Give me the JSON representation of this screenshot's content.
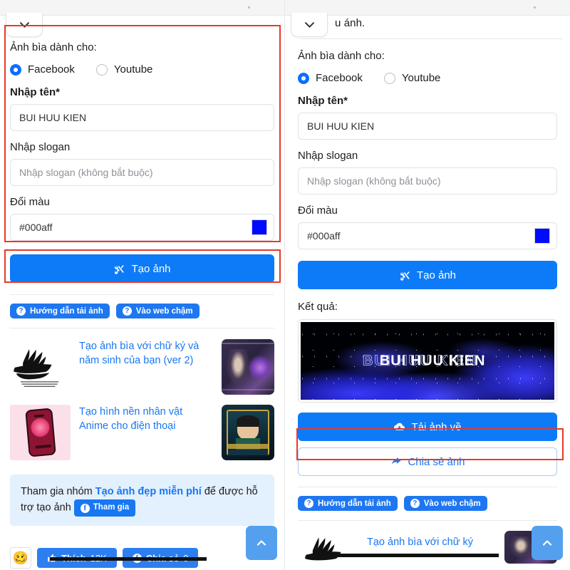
{
  "header": {
    "collapse_icon": "chevron-down-icon",
    "right_partial_text": "u ánh."
  },
  "form": {
    "cover_for_label": "Ảnh bìa dành cho:",
    "radios": [
      {
        "label": "Facebook",
        "selected": true
      },
      {
        "label": "Youtube",
        "selected": false
      }
    ],
    "name_label": "Nhập tên*",
    "name_value": "BUI HUU KIEN",
    "slogan_label": "Nhập slogan",
    "slogan_placeholder": "Nhập slogan (không bắt buộc)",
    "color_label": "Đổi màu",
    "color_value": "#000aff",
    "color_swatch_hex": "#000aff",
    "create_button": "Tạo ảnh",
    "create_button_icon": "scissors-icon"
  },
  "result": {
    "label": "Kết quả:",
    "cover_text": "BUI HUU KIEN",
    "download_button": "Tải ảnh về",
    "download_icon": "cloud-download-icon",
    "share_button": "Chia sẻ ảnh",
    "share_icon": "share-arrow-icon"
  },
  "help_pills": [
    {
      "label": "Hướng dẫn tải ảnh",
      "icon": "question-circle-icon"
    },
    {
      "label": "Vào web chậm",
      "icon": "question-circle-icon"
    }
  ],
  "articles": [
    {
      "title": "Tạo ảnh bìa với chữ ký và năm sinh của bạn (ver 2)"
    },
    {
      "title": "Tạo hình nền nhân vật Anime cho điện thoại"
    }
  ],
  "article_partial": {
    "title": "Tạo ảnh bìa với chữ ký"
  },
  "join_banner": {
    "prefix": "Tham gia nhóm ",
    "group_name": "Tạo ảnh đẹp miễn phí",
    "suffix": " để được hỗ trợ tạo ảnh",
    "button": "Tham gia",
    "button_icon": "facebook-icon"
  },
  "social_bar": {
    "emoji": "🥴",
    "like_label": "Thích",
    "like_count": "12K",
    "like_icon": "thumbs-up-icon",
    "share_label": "Chia sẻ",
    "share_count": "0",
    "share_icon": "facebook-share-icon"
  },
  "scroll_top": {
    "icon": "chevron-up-icon"
  },
  "colors": {
    "primary_blue": "#0d7bf7",
    "pill_blue": "#1e77f0",
    "link_blue": "#1877f2",
    "annotation_red": "#e8392b",
    "swatch_blue": "#000aff",
    "scroll_top_blue": "#54a0ee"
  }
}
